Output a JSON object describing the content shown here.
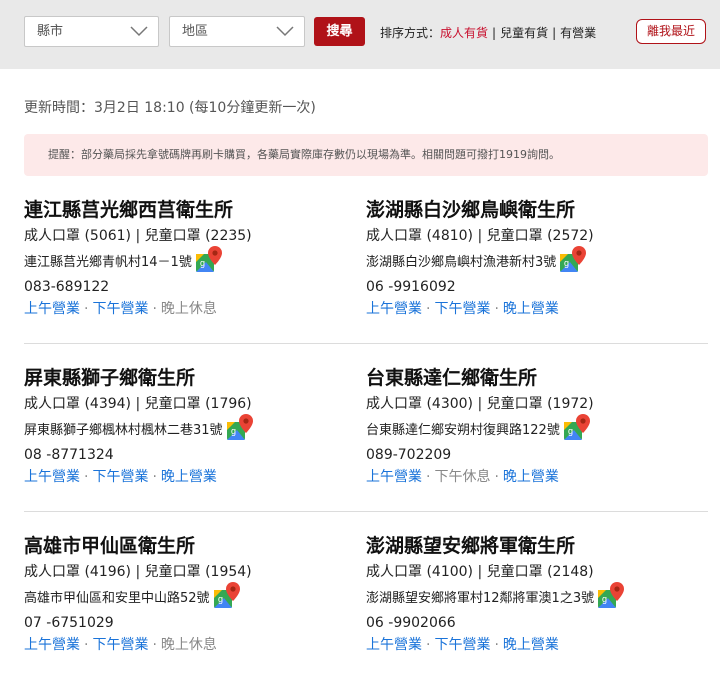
{
  "filters": {
    "county_label": "縣市",
    "district_label": "地區",
    "search_label": "搜尋",
    "sort_prefix": "排序方式：",
    "sort_options": [
      "成人有貨",
      "兒童有貨",
      "有營業"
    ],
    "nearest_label": "離我最近"
  },
  "update_text": "更新時間：3月2日 18:10 (每10分鐘更新一次)",
  "notice_text": "提醒：部分藥局採先拿號碼牌再刷卡購買，各藥局實際庫存數仍以現場為準。相關問題可撥打1919詢問。",
  "accent_color": "#b01218",
  "open_color": "#1a73d9",
  "closed_color": "#888888",
  "stores": [
    {
      "name": "連江縣莒光鄉西莒衛生所",
      "stock": "成人口罩 (5061) | 兒童口罩 (2235)",
      "address": "連江縣莒光鄉青帆村14－1號",
      "phone": "083-689122",
      "hours": [
        {
          "label": "上午營業",
          "open": true
        },
        {
          "label": "下午營業",
          "open": true
        },
        {
          "label": "晚上休息",
          "open": false
        }
      ]
    },
    {
      "name": "澎湖縣白沙鄉鳥嶼衛生所",
      "stock": "成人口罩 (4810) | 兒童口罩 (2572)",
      "address": "澎湖縣白沙鄉鳥嶼村漁港新村3號",
      "phone": "06 -9916092",
      "hours": [
        {
          "label": "上午營業",
          "open": true
        },
        {
          "label": "下午營業",
          "open": true
        },
        {
          "label": "晚上營業",
          "open": true
        }
      ]
    },
    {
      "name": "屏東縣獅子鄉衛生所",
      "stock": "成人口罩 (4394) | 兒童口罩 (1796)",
      "address": "屏東縣獅子鄉楓林村楓林二巷31號",
      "phone": "08 -8771324",
      "hours": [
        {
          "label": "上午營業",
          "open": true
        },
        {
          "label": "下午營業",
          "open": true
        },
        {
          "label": "晚上營業",
          "open": true
        }
      ]
    },
    {
      "name": "台東縣達仁鄉衛生所",
      "stock": "成人口罩 (4300) | 兒童口罩 (1972)",
      "address": "台東縣達仁鄉安朔村復興路122號",
      "phone": "089-702209",
      "hours": [
        {
          "label": "上午營業",
          "open": true
        },
        {
          "label": "下午休息",
          "open": false
        },
        {
          "label": "晚上營業",
          "open": true
        }
      ]
    },
    {
      "name": "高雄市甲仙區衛生所",
      "stock": "成人口罩 (4196) | 兒童口罩 (1954)",
      "address": "高雄市甲仙區和安里中山路52號",
      "phone": "07 -6751029",
      "hours": [
        {
          "label": "上午營業",
          "open": true
        },
        {
          "label": "下午營業",
          "open": true
        },
        {
          "label": "晚上休息",
          "open": false
        }
      ]
    },
    {
      "name": "澎湖縣望安鄉將軍衛生所",
      "stock": "成人口罩 (4100) | 兒童口罩 (2148)",
      "address": "澎湖縣望安鄉將軍村12鄰將軍澳1之3號",
      "phone": "06 -9902066",
      "hours": [
        {
          "label": "上午營業",
          "open": true
        },
        {
          "label": "下午營業",
          "open": true
        },
        {
          "label": "晚上營業",
          "open": true
        }
      ]
    }
  ]
}
